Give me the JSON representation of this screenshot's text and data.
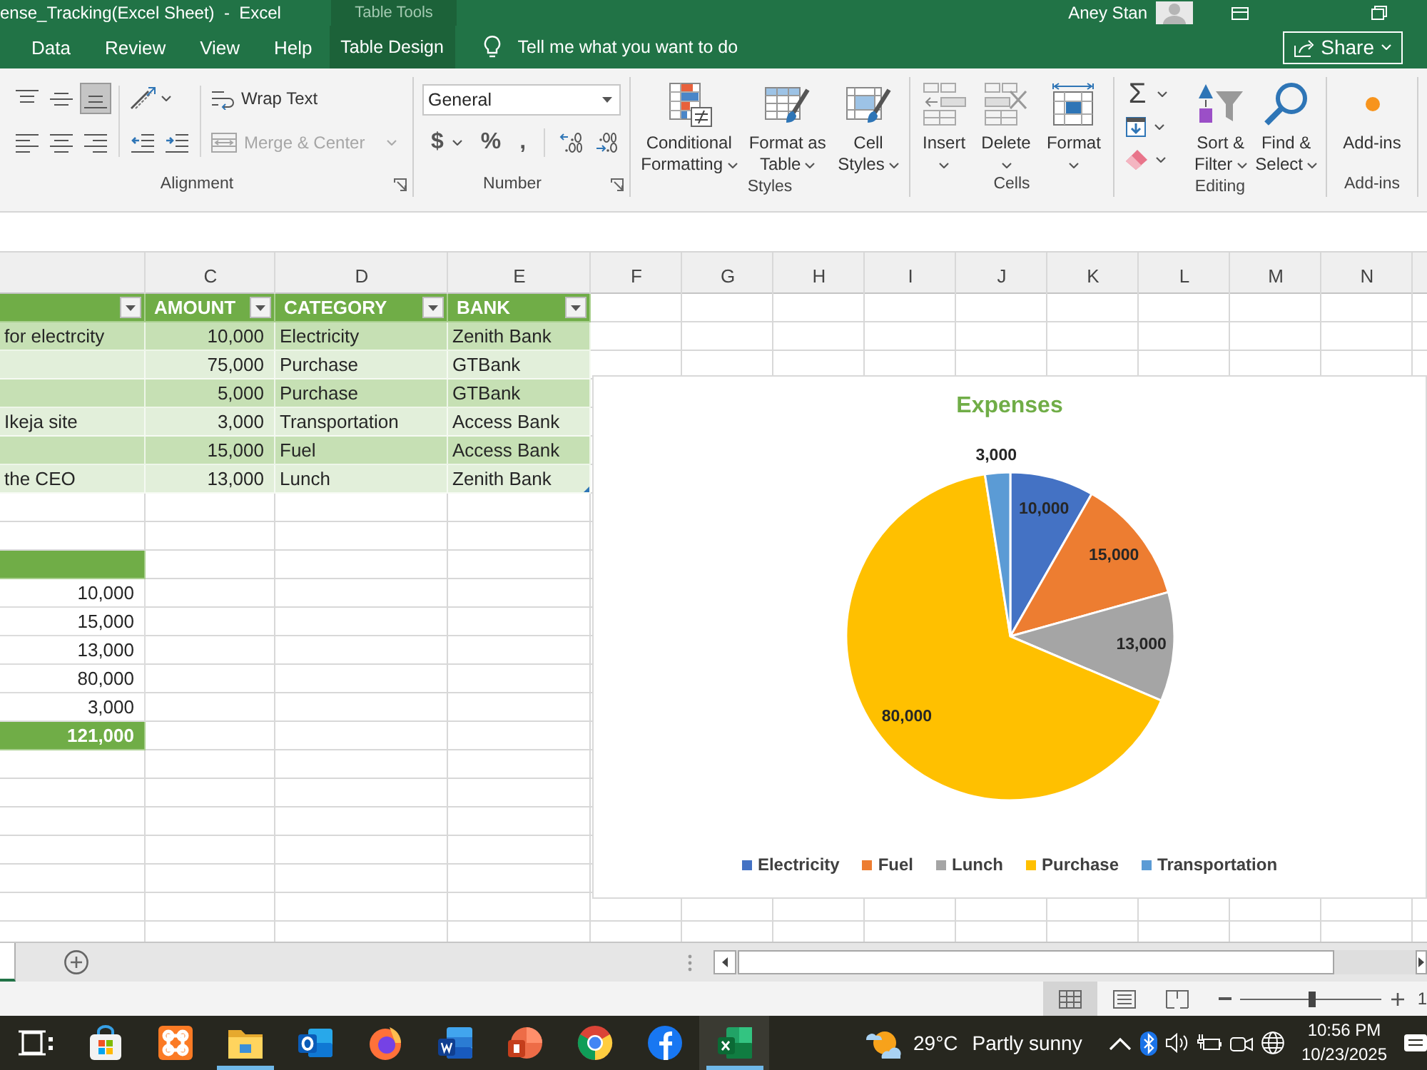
{
  "title_bar": {
    "title": "ense_Tracking(Excel Sheet)  -  Excel",
    "context_label": "Table Tools",
    "user": "Aney Stan"
  },
  "ribbon_tabs": [
    {
      "label": "Data",
      "kind": "standard",
      "selected": false
    },
    {
      "label": "Review",
      "kind": "standard",
      "selected": false
    },
    {
      "label": "View",
      "kind": "standard",
      "selected": false
    },
    {
      "label": "Help",
      "kind": "standard",
      "selected": false
    },
    {
      "label": "Table Design",
      "kind": "contextual",
      "selected": false
    }
  ],
  "tell_me": {
    "placeholder": "Tell me what you want to do"
  },
  "share_button": {
    "label": "Share"
  },
  "ribbon": {
    "alignment": {
      "label": "Alignment",
      "vertical_align": [
        {
          "kind": "top",
          "selected": false
        },
        {
          "kind": "middle",
          "selected": false
        },
        {
          "kind": "bottom",
          "selected": true
        }
      ],
      "horizontal_align": [
        {
          "kind": "left",
          "selected": false
        },
        {
          "kind": "center",
          "selected": false
        },
        {
          "kind": "right",
          "selected": false
        }
      ],
      "wrap_text": {
        "label": "Wrap Text"
      },
      "merge": {
        "label": "Merge & Center",
        "disabled": true
      }
    },
    "number": {
      "label": "Number",
      "format": "General",
      "buttons": [
        {
          "symbol": "$",
          "dropdown": true
        },
        {
          "symbol": "%",
          "dropdown": false
        },
        {
          "symbol": ",",
          "dropdown": false
        }
      ]
    },
    "styles": {
      "label": "Styles",
      "buttons": [
        {
          "kind": "conditional",
          "lines": [
            "Conditional",
            "Formatting"
          ],
          "dropdown": true
        },
        {
          "kind": "table",
          "lines": [
            "Format as",
            "Table"
          ],
          "dropdown": true
        },
        {
          "kind": "cellstyles",
          "lines": [
            "Cell",
            "Styles"
          ],
          "dropdown": true
        }
      ]
    },
    "cells": {
      "label": "Cells",
      "buttons": [
        {
          "kind": "insert",
          "lines": [
            "Insert"
          ],
          "dropdown": true
        },
        {
          "kind": "delete",
          "lines": [
            "Delete"
          ],
          "dropdown": true
        },
        {
          "kind": "format",
          "lines": [
            "Format"
          ],
          "dropdown": true
        }
      ]
    },
    "editing": {
      "label": "Editing",
      "small_buttons": [
        {
          "kind": "autosum",
          "symbol": "Σ",
          "dropdown": true
        },
        {
          "kind": "fill",
          "dropdown": true
        },
        {
          "kind": "clear",
          "dropdown": true
        }
      ],
      "buttons": [
        {
          "kind": "sort",
          "lines": [
            "Sort &",
            "Filter"
          ],
          "dropdown": true
        },
        {
          "kind": "find",
          "lines": [
            "Find &",
            "Select"
          ],
          "dropdown": true
        }
      ]
    },
    "addins": {
      "label": "Add-ins",
      "buttons": [
        {
          "kind": "addins",
          "lines": [
            "Add-ins"
          ],
          "dropdown": false
        }
      ]
    }
  },
  "sheet": {
    "column_headers": [
      "C",
      "D",
      "E",
      "F",
      "G",
      "H",
      "I",
      "J",
      "K",
      "L",
      "M",
      "N"
    ],
    "table": {
      "headers": [
        "AMOUNT",
        "CATEGORY",
        "BANK"
      ],
      "rows": [
        {
          "description": "for electrcity",
          "amount": "10,000",
          "category": "Electricity",
          "bank": "Zenith Bank"
        },
        {
          "amount": "75,000",
          "category": "Purchase",
          "bank": "GTBank"
        },
        {
          "amount": "5,000",
          "category": "Purchase",
          "bank": "GTBank"
        },
        {
          "description": "Ikeja site",
          "amount": "3,000",
          "category": "Transportation",
          "bank": "Access Bank"
        },
        {
          "amount": "15,000",
          "category": "Fuel",
          "bank": "Access Bank"
        },
        {
          "description": "the CEO",
          "amount": "13,000",
          "category": "Lunch",
          "bank": "Zenith Bank"
        }
      ]
    },
    "summary": {
      "values": [
        "10,000",
        "15,000",
        "13,000",
        "80,000",
        "3,000"
      ],
      "total": "121,000"
    },
    "chart": {
      "chart_data": {
        "type": "pie",
        "title": "Expenses",
        "categories": [
          "Electricity",
          "Fuel",
          "Lunch",
          "Purchase",
          "Transportation"
        ],
        "values": [
          10000,
          15000,
          13000,
          80000,
          3000
        ],
        "value_labels": [
          "10,000",
          "15,000",
          "13,000",
          "80,000",
          "3,000"
        ],
        "colors": [
          "#4472c4",
          "#ed7d31",
          "#a5a5a5",
          "#ffc000",
          "#5b9bd5"
        ],
        "legend": "bottom"
      }
    }
  },
  "sheet_tabs": [
    {
      "selected": true
    }
  ],
  "status_bar": {
    "views": [
      {
        "kind": "normal",
        "selected": true
      },
      {
        "kind": "page_layout",
        "selected": false
      },
      {
        "kind": "page_break",
        "selected": false
      }
    ],
    "zoom": {
      "level": 0.5,
      "text": "1"
    }
  },
  "taskbar": {
    "apps": [
      {
        "kind": "task_view",
        "running": false,
        "selected": false
      },
      {
        "kind": "store",
        "running": false,
        "selected": false
      },
      {
        "kind": "xampp",
        "running": false,
        "selected": false
      },
      {
        "kind": "explorer",
        "running": true,
        "selected": false
      },
      {
        "kind": "outlook",
        "running": false,
        "selected": false
      },
      {
        "kind": "firefox",
        "running": false,
        "selected": false
      },
      {
        "kind": "word",
        "running": false,
        "selected": false
      },
      {
        "kind": "powerpoint",
        "running": false,
        "selected": false
      },
      {
        "kind": "chrome",
        "running": false,
        "selected": false
      },
      {
        "kind": "facebook",
        "running": false,
        "selected": false
      },
      {
        "kind": "excel",
        "running": true,
        "selected": true
      }
    ],
    "weather": {
      "temperature": "29°C",
      "condition": "Partly sunny"
    },
    "clock": {
      "time": "10:56 PM",
      "date": "10/23/2025"
    }
  }
}
